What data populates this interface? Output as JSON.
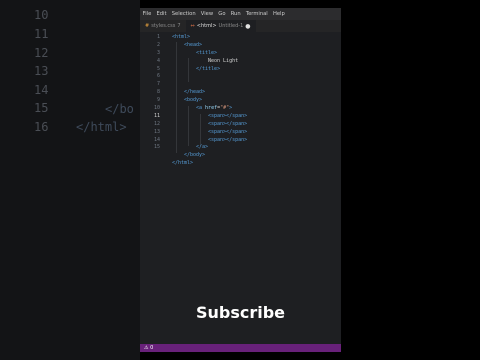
{
  "menubar": {
    "items": [
      "File",
      "Edit",
      "Selection",
      "View",
      "Go",
      "Run",
      "Terminal",
      "Help"
    ]
  },
  "tabs": [
    {
      "icon": "css-file-icon",
      "label": "styles.css",
      "marker": "7"
    },
    {
      "icon": "html-file-icon",
      "label": "<html>",
      "sublabel": "Untitled-1",
      "dirty": "●"
    }
  ],
  "editor": {
    "current_line": 11,
    "line_numbers": [
      "1",
      "2",
      "3",
      "4",
      "5",
      "6",
      "7",
      "8",
      "9",
      "10",
      "11",
      "12",
      "13",
      "14",
      "15"
    ],
    "tokens": {
      "html_open": "<html>",
      "head_open": "<head>",
      "title_open": "<title>",
      "title_text": "Neon Light",
      "title_close": "</title>",
      "head_close": "</head>",
      "body_open": "<body>",
      "a_start": "<a",
      "a_attr": "href",
      "a_eq": "=",
      "a_val": "\"#\"",
      "a_end": ">",
      "span_pair": "<span></span>",
      "a_close": "</a>",
      "body_close": "</body>",
      "html_close": "</html>"
    }
  },
  "statusbar": {
    "problems": "⚠ 0"
  },
  "overlay": {
    "text": "Subscribe"
  },
  "background": {
    "line_numbers": [
      "10",
      "11",
      "12",
      "13",
      "14",
      "15",
      "16"
    ],
    "fragments": [
      "</bo",
      "</html>"
    ]
  }
}
